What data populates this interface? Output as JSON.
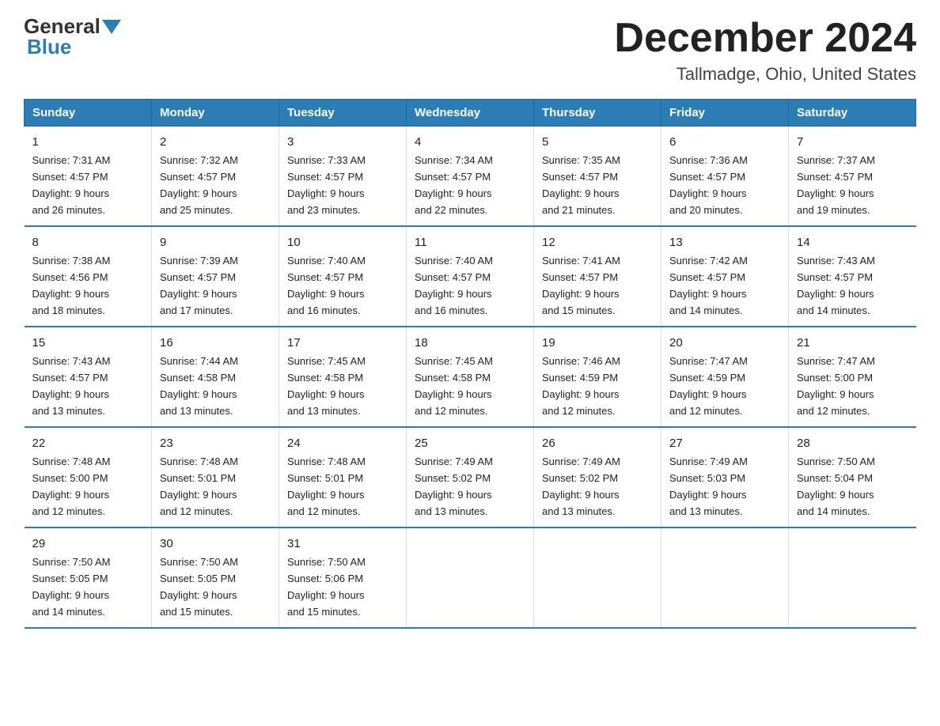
{
  "logo": {
    "general": "General",
    "blue": "Blue"
  },
  "title": "December 2024",
  "subtitle": "Tallmadge, Ohio, United States",
  "weekdays": [
    "Sunday",
    "Monday",
    "Tuesday",
    "Wednesday",
    "Thursday",
    "Friday",
    "Saturday"
  ],
  "weeks": [
    [
      {
        "day": "1",
        "sunrise": "7:31 AM",
        "sunset": "4:57 PM",
        "daylight": "9 hours and 26 minutes."
      },
      {
        "day": "2",
        "sunrise": "7:32 AM",
        "sunset": "4:57 PM",
        "daylight": "9 hours and 25 minutes."
      },
      {
        "day": "3",
        "sunrise": "7:33 AM",
        "sunset": "4:57 PM",
        "daylight": "9 hours and 23 minutes."
      },
      {
        "day": "4",
        "sunrise": "7:34 AM",
        "sunset": "4:57 PM",
        "daylight": "9 hours and 22 minutes."
      },
      {
        "day": "5",
        "sunrise": "7:35 AM",
        "sunset": "4:57 PM",
        "daylight": "9 hours and 21 minutes."
      },
      {
        "day": "6",
        "sunrise": "7:36 AM",
        "sunset": "4:57 PM",
        "daylight": "9 hours and 20 minutes."
      },
      {
        "day": "7",
        "sunrise": "7:37 AM",
        "sunset": "4:57 PM",
        "daylight": "9 hours and 19 minutes."
      }
    ],
    [
      {
        "day": "8",
        "sunrise": "7:38 AM",
        "sunset": "4:56 PM",
        "daylight": "9 hours and 18 minutes."
      },
      {
        "day": "9",
        "sunrise": "7:39 AM",
        "sunset": "4:57 PM",
        "daylight": "9 hours and 17 minutes."
      },
      {
        "day": "10",
        "sunrise": "7:40 AM",
        "sunset": "4:57 PM",
        "daylight": "9 hours and 16 minutes."
      },
      {
        "day": "11",
        "sunrise": "7:40 AM",
        "sunset": "4:57 PM",
        "daylight": "9 hours and 16 minutes."
      },
      {
        "day": "12",
        "sunrise": "7:41 AM",
        "sunset": "4:57 PM",
        "daylight": "9 hours and 15 minutes."
      },
      {
        "day": "13",
        "sunrise": "7:42 AM",
        "sunset": "4:57 PM",
        "daylight": "9 hours and 14 minutes."
      },
      {
        "day": "14",
        "sunrise": "7:43 AM",
        "sunset": "4:57 PM",
        "daylight": "9 hours and 14 minutes."
      }
    ],
    [
      {
        "day": "15",
        "sunrise": "7:43 AM",
        "sunset": "4:57 PM",
        "daylight": "9 hours and 13 minutes."
      },
      {
        "day": "16",
        "sunrise": "7:44 AM",
        "sunset": "4:58 PM",
        "daylight": "9 hours and 13 minutes."
      },
      {
        "day": "17",
        "sunrise": "7:45 AM",
        "sunset": "4:58 PM",
        "daylight": "9 hours and 13 minutes."
      },
      {
        "day": "18",
        "sunrise": "7:45 AM",
        "sunset": "4:58 PM",
        "daylight": "9 hours and 12 minutes."
      },
      {
        "day": "19",
        "sunrise": "7:46 AM",
        "sunset": "4:59 PM",
        "daylight": "9 hours and 12 minutes."
      },
      {
        "day": "20",
        "sunrise": "7:47 AM",
        "sunset": "4:59 PM",
        "daylight": "9 hours and 12 minutes."
      },
      {
        "day": "21",
        "sunrise": "7:47 AM",
        "sunset": "5:00 PM",
        "daylight": "9 hours and 12 minutes."
      }
    ],
    [
      {
        "day": "22",
        "sunrise": "7:48 AM",
        "sunset": "5:00 PM",
        "daylight": "9 hours and 12 minutes."
      },
      {
        "day": "23",
        "sunrise": "7:48 AM",
        "sunset": "5:01 PM",
        "daylight": "9 hours and 12 minutes."
      },
      {
        "day": "24",
        "sunrise": "7:48 AM",
        "sunset": "5:01 PM",
        "daylight": "9 hours and 12 minutes."
      },
      {
        "day": "25",
        "sunrise": "7:49 AM",
        "sunset": "5:02 PM",
        "daylight": "9 hours and 13 minutes."
      },
      {
        "day": "26",
        "sunrise": "7:49 AM",
        "sunset": "5:02 PM",
        "daylight": "9 hours and 13 minutes."
      },
      {
        "day": "27",
        "sunrise": "7:49 AM",
        "sunset": "5:03 PM",
        "daylight": "9 hours and 13 minutes."
      },
      {
        "day": "28",
        "sunrise": "7:50 AM",
        "sunset": "5:04 PM",
        "daylight": "9 hours and 14 minutes."
      }
    ],
    [
      {
        "day": "29",
        "sunrise": "7:50 AM",
        "sunset": "5:05 PM",
        "daylight": "9 hours and 14 minutes."
      },
      {
        "day": "30",
        "sunrise": "7:50 AM",
        "sunset": "5:05 PM",
        "daylight": "9 hours and 15 minutes."
      },
      {
        "day": "31",
        "sunrise": "7:50 AM",
        "sunset": "5:06 PM",
        "daylight": "9 hours and 15 minutes."
      },
      {
        "day": "",
        "sunrise": "",
        "sunset": "",
        "daylight": ""
      },
      {
        "day": "",
        "sunrise": "",
        "sunset": "",
        "daylight": ""
      },
      {
        "day": "",
        "sunrise": "",
        "sunset": "",
        "daylight": ""
      },
      {
        "day": "",
        "sunrise": "",
        "sunset": "",
        "daylight": ""
      }
    ]
  ],
  "labels": {
    "sunrise": "Sunrise:",
    "sunset": "Sunset:",
    "daylight": "Daylight:"
  }
}
